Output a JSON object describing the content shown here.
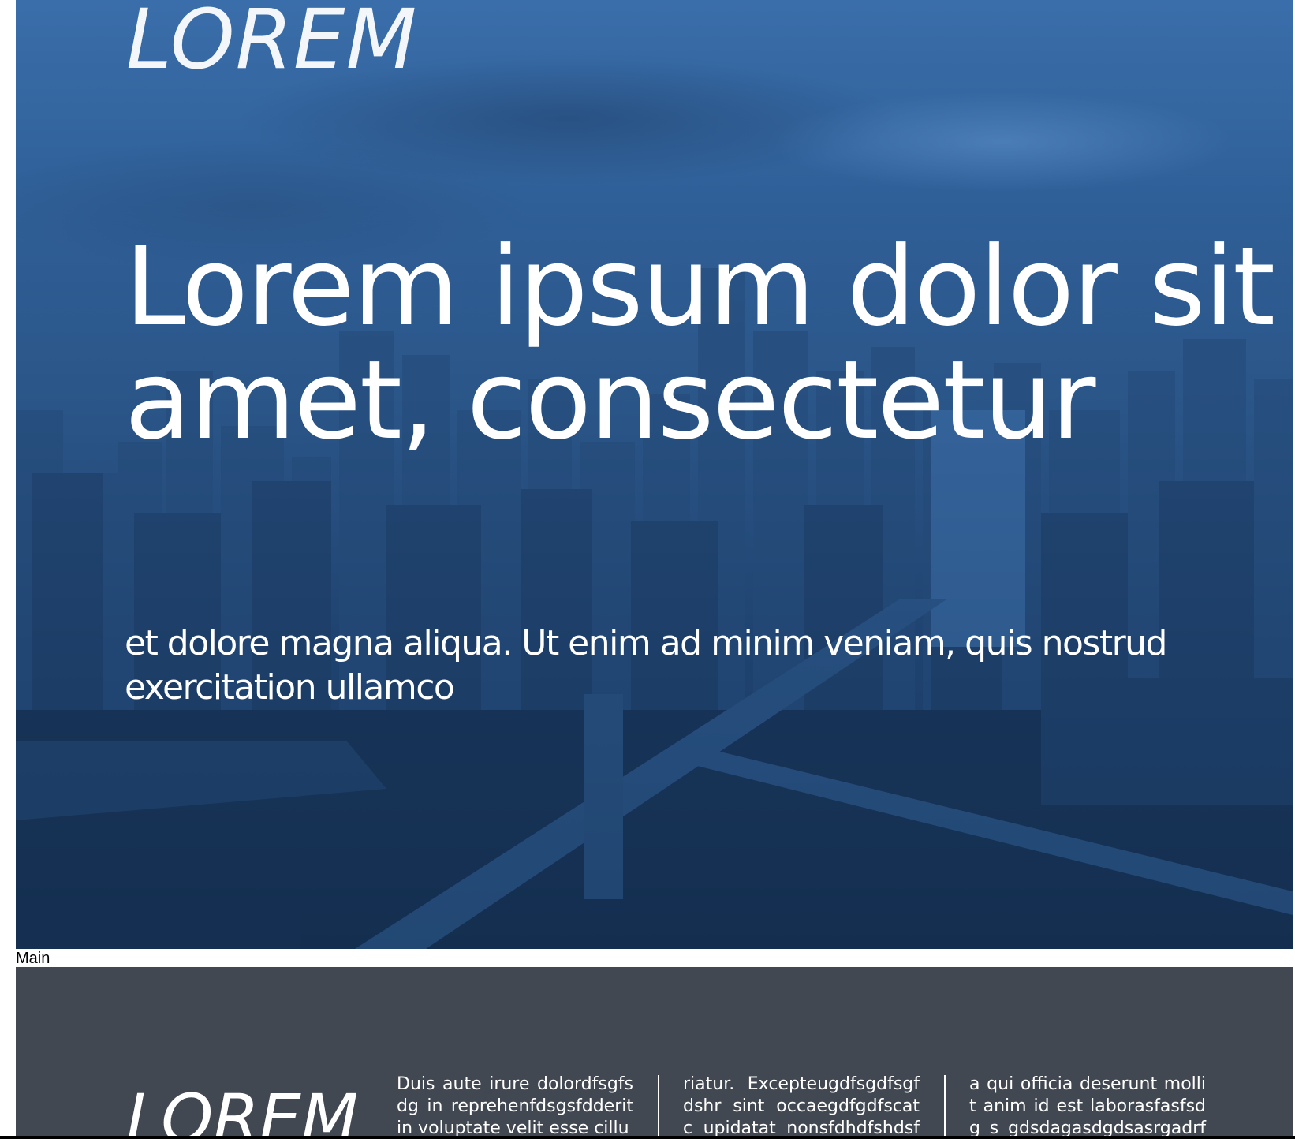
{
  "hero": {
    "logo": "LOREM",
    "headline": "Lorem ipsum dolor sit amet, consectetur",
    "subtext": "et dolore magna aliqua. Ut enim ad minim veniam, quis nostrud exercitation ullamco"
  },
  "section_label": "Main",
  "footer": {
    "logo": "LOREM",
    "columns": [
      {
        "text": "Duis aute irure dolordfsgfs dg in reprehenfdsgsfdderit in voluptate velit esse cillu"
      },
      {
        "text": "riatur. Excepteugdfsgdfsgf dshr sint occaegdfgdfscat c upidatat nonsfdhdfshdsf pr"
      },
      {
        "text": "a qui officia deserunt mollit anim id est laborasfasfsdg s gdsdagasdgdsasrgadrfgasf"
      }
    ]
  },
  "colors": {
    "hero_blue": "#2f5f97",
    "footer_bg": "#424851",
    "text_light": "#ffffff"
  }
}
